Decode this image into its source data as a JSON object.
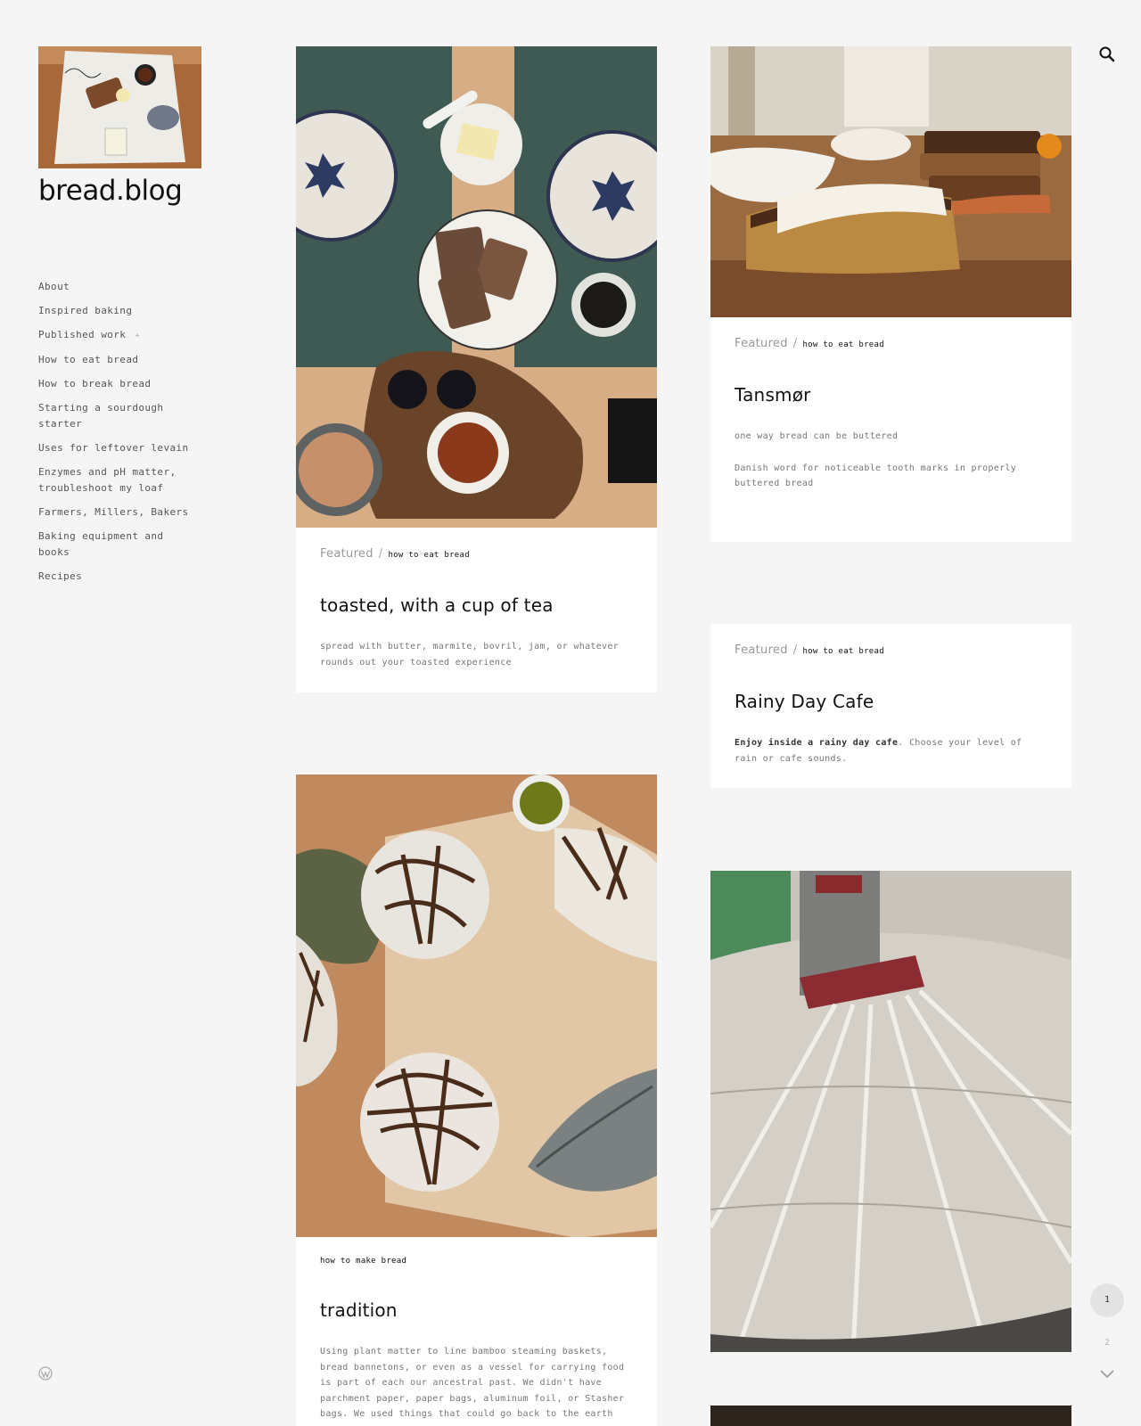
{
  "site": {
    "title": "bread.blog"
  },
  "menu": [
    {
      "label": "About"
    },
    {
      "label": "Inspired baking"
    },
    {
      "label": "Published work",
      "dropdown": "+"
    },
    {
      "label": "How to eat bread"
    },
    {
      "label": "How to break bread"
    },
    {
      "label": "Starting a sourdough starter"
    },
    {
      "label": "Uses for leftover levain"
    },
    {
      "label": "Enzymes and pH matter, troubleshoot my loaf"
    },
    {
      "label": "Farmers, Millers, Bakers"
    },
    {
      "label": "Baking equipment and books"
    },
    {
      "label": "Recipes"
    }
  ],
  "posts": {
    "toast": {
      "featured": "Featured",
      "sep": "/",
      "category": "how to eat bread",
      "title": "toasted, with a cup of tea",
      "excerpt": "spread with butter, marmite, bovril, jam, or whatever rounds out your toasted experience"
    },
    "tansmor": {
      "featured": "Featured",
      "sep": "/",
      "category": "how to eat bread",
      "title": "Tansmør",
      "excerpt1": "one way bread can be buttered",
      "excerpt2": "Danish word for noticeable tooth marks in properly buttered bread"
    },
    "rainy": {
      "featured": "Featured",
      "sep": "/",
      "category": "how to eat bread",
      "title": "Rainy Day Cafe",
      "excerpt_bold": "Enjoy inside a rainy day cafe",
      "excerpt_rest": ". Choose your level of rain or cafe sounds."
    },
    "tradition": {
      "category": "how to make bread",
      "title": "tradition",
      "excerpt": "Using plant matter to line bamboo steaming baskets, bread bannetons, or even as a vessel for carrying food is part of each our ancestral past. We didn't have parchment paper, paper bags, aluminum foil, or Stasher bags. We used things that could go back to the earth"
    }
  },
  "pagination": {
    "current": "1",
    "next_page": "2"
  },
  "icons": {
    "search": "search-icon",
    "wordpress": "wordpress-icon",
    "next": "chevron-down-icon"
  }
}
